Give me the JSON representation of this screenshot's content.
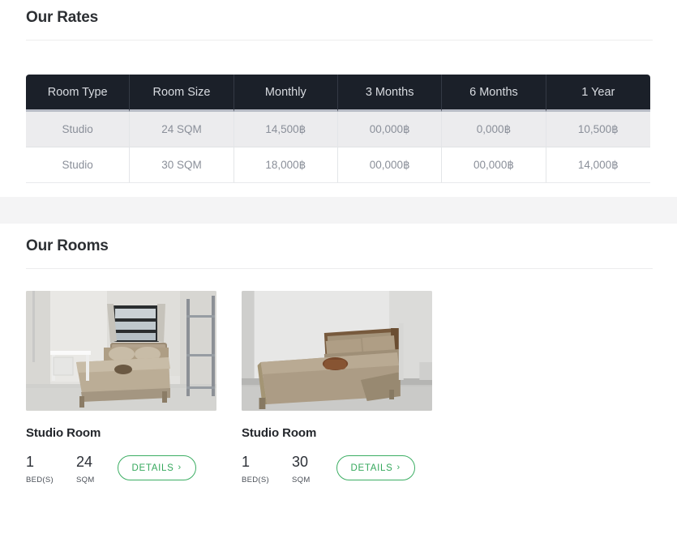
{
  "rates_section": {
    "title": "Our Rates",
    "table": {
      "columns": [
        "Room Type",
        "Room Size",
        "Monthly",
        "3 Months",
        "6 Months",
        "1 Year"
      ],
      "rows": [
        {
          "room_type": "Studio",
          "room_size": "24 SQM",
          "monthly": "14,500฿",
          "three_months": "00,000฿",
          "six_months": "0,000฿",
          "one_year": "10,500฿"
        },
        {
          "room_type": "Studio",
          "room_size": "30 SQM",
          "monthly": "18,000฿",
          "three_months": "00,000฿",
          "six_months": "00,000฿",
          "one_year": "14,000฿"
        }
      ]
    }
  },
  "rooms_section": {
    "title": "Our Rooms",
    "cards": [
      {
        "photo_alt": "studio-room-photo-with-window-desk-and-shelf",
        "name": "Studio Room",
        "beds_value": "1",
        "beds_label": "BED(S)",
        "size_value": "24",
        "size_label": "SQM",
        "details_label": "DETAILS",
        "details_chevron": "›"
      },
      {
        "photo_alt": "studio-room-photo-with-large-bed",
        "name": "Studio Room",
        "beds_value": "1",
        "beds_label": "BED(S)",
        "size_value": "30",
        "size_label": "SQM",
        "details_label": "DETAILS",
        "details_chevron": "›"
      }
    ]
  },
  "colors": {
    "table_header_bg": "#1b2029",
    "table_header_text": "#d8dbe0",
    "row_alt_bg": "#ececee",
    "cell_text": "#8a8f99",
    "band_bg": "#f4f4f5",
    "accent_green": "#35a85c",
    "heading_text": "#2c2f33"
  }
}
